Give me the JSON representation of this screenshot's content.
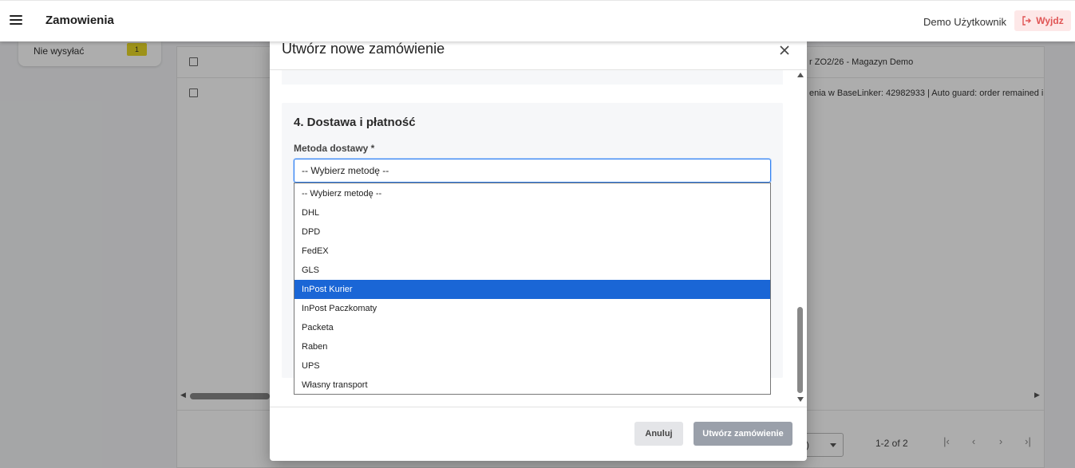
{
  "app": {
    "title": "Zamowienia",
    "user": "Demo Użytkownik",
    "logout_label": "Wyjdz"
  },
  "sidebar": {
    "label": "Nie wysyłać",
    "badge": "1"
  },
  "table": {
    "rows": [
      {
        "text": "r ZO2/26 - Magazyn Demo"
      },
      {
        "text": "enia w BaseLinker: 42982933 | Auto guard: order remained in W"
      }
    ]
  },
  "pagination": {
    "range": "1-2 of 2",
    "select_value": ")"
  },
  "modal": {
    "title": "Utwórz nowe zamówienie",
    "section_title": "4. Dostawa i płatność",
    "field_label": "Metoda dostawy *",
    "select_value": "-- Wybierz metodę --",
    "cancel_label": "Anuluj",
    "create_label": "Utwórz zamówienie"
  },
  "dropdown": {
    "options": [
      "-- Wybierz metodę --",
      "DHL",
      "DPD",
      "FedEX",
      "GLS",
      "InPost Kurier",
      "InPost Paczkomaty",
      "Packeta",
      "Raben",
      "UPS",
      "Własny transport"
    ],
    "highlighted": "InPost Kurier"
  },
  "colors": {
    "accent": "#1a66d6",
    "logout_bg": "#fde8e8",
    "logout_fg": "#e05555",
    "badge": "#e8d825"
  }
}
